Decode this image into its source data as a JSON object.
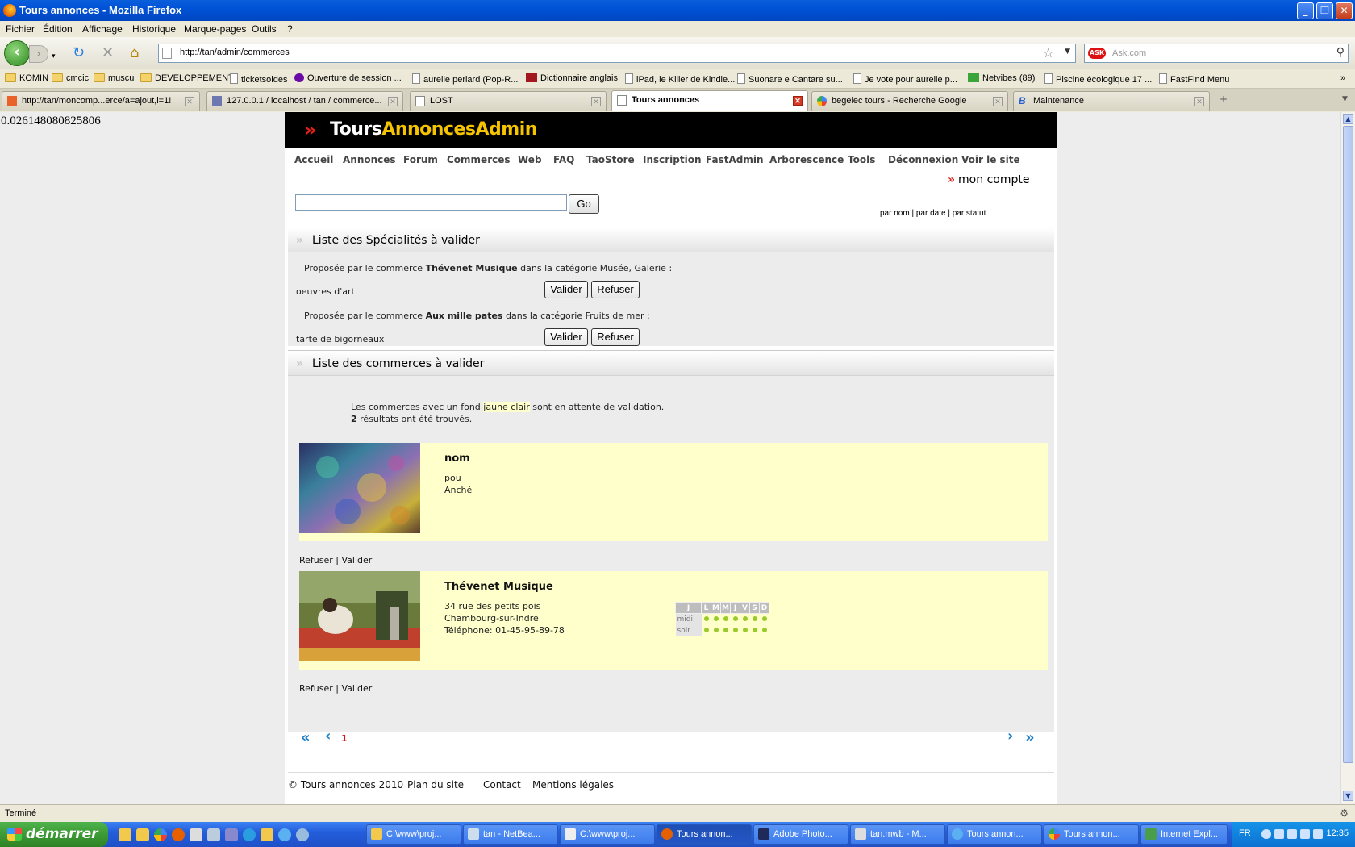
{
  "window": {
    "title": "Tours annonces - Mozilla Firefox"
  },
  "menu": [
    "Fichier",
    "Édition",
    "Affichage",
    "Historique",
    "Marque-pages",
    "Outils",
    "?"
  ],
  "nav": {
    "url": "http://tan/admin/commerces",
    "search_placeholder": "Ask.com"
  },
  "bookmarks": [
    "KOMIN",
    "cmcic",
    "muscu",
    "DEVELOPPEMENT",
    "ticketsoldes",
    "Ouverture de session ...",
    "aurelie periard (Pop-R...",
    "Dictionnaire anglais",
    "iPad, le Killer de Kindle...",
    "Suonare e Cantare su...",
    "Je vote pour aurelie p...",
    "Netvibes (89)",
    "Piscine écologique 17 ...",
    "FastFind Menu"
  ],
  "tabs": [
    "http://tan/moncomp...erce/a=ajout,i=1!",
    "127.0.0.1 / localhost / tan / commerce...",
    "LOST",
    "Tours annonces",
    "begelec tours - Recherche Google",
    "Maintenance"
  ],
  "debug_value": "0.026148080825806",
  "site": {
    "logo_white": "Tours",
    "logo_yellow": "AnnoncesAdmin",
    "nav": [
      "Accueil",
      "Annonces",
      "Forum",
      "Commerces",
      "Web",
      "FAQ",
      "TaoStore",
      "Inscription",
      "FastAdmin",
      "Arborescence",
      "Tools",
      "Déconnexion",
      "Voir le site"
    ],
    "mon_compte": "mon compte",
    "go": "Go",
    "sort": {
      "nom": "par nom",
      "date": "par date",
      "statut": "par statut"
    },
    "specialites": {
      "title": "Liste des Spécialités à valider",
      "items": [
        {
          "prefix": "Proposée par le commerce",
          "commerce": "Thévenet Musique",
          "mid": "dans la catégorie",
          "categorie": "Musée, Galerie :",
          "name": "oeuvres d'art"
        },
        {
          "prefix": "Proposée par le commerce",
          "commerce": "Aux mille pates",
          "mid": "dans la catégorie",
          "categorie": "Fruits de mer :",
          "name": "tarte de bigorneaux"
        }
      ],
      "valider": "Valider",
      "refuser": "Refuser"
    },
    "commerces": {
      "title": "Liste des commerces à valider",
      "info_pre": "Les commerces avec un fond",
      "info_hl": "jaune clair",
      "info_post": "sont en attente de validation.",
      "count": "2",
      "count_text": "résultats ont été trouvés.",
      "cards": [
        {
          "name": "nom",
          "line1": "pou",
          "line2": "Anché",
          "line3": ""
        },
        {
          "name": "Thévenet Musique",
          "line1": "34 rue des petits pois",
          "line2": "Chambourg-sur-Indre",
          "line3": "Téléphone: 01-45-95-89-78"
        }
      ],
      "actions": {
        "refuser": "Refuser",
        "sep": "|",
        "valider": "Valider"
      },
      "hours": {
        "days": [
          "J",
          "L",
          "M",
          "M",
          "J",
          "V",
          "S",
          "D"
        ],
        "rows": [
          "midi",
          "soir"
        ]
      }
    },
    "pager": {
      "first": "«",
      "prev": "‹",
      "page": "1",
      "next": "›",
      "last": "»"
    },
    "footer": {
      "copy": "© Tours annonces 2010",
      "plan": "Plan du site",
      "contact": "Contact",
      "mentions": "Mentions légales"
    }
  },
  "status": "Terminé",
  "taskbar": {
    "start": "démarrer",
    "tasks": [
      "C:\\www\\proj...",
      "tan - NetBea...",
      "C:\\www\\proj...",
      "Tours annon...",
      "Adobe Photo...",
      "tan.mwb - M...",
      "Tours annon...",
      "Tours annon...",
      "Internet Expl..."
    ],
    "lang": "FR",
    "clock": "12:35"
  }
}
